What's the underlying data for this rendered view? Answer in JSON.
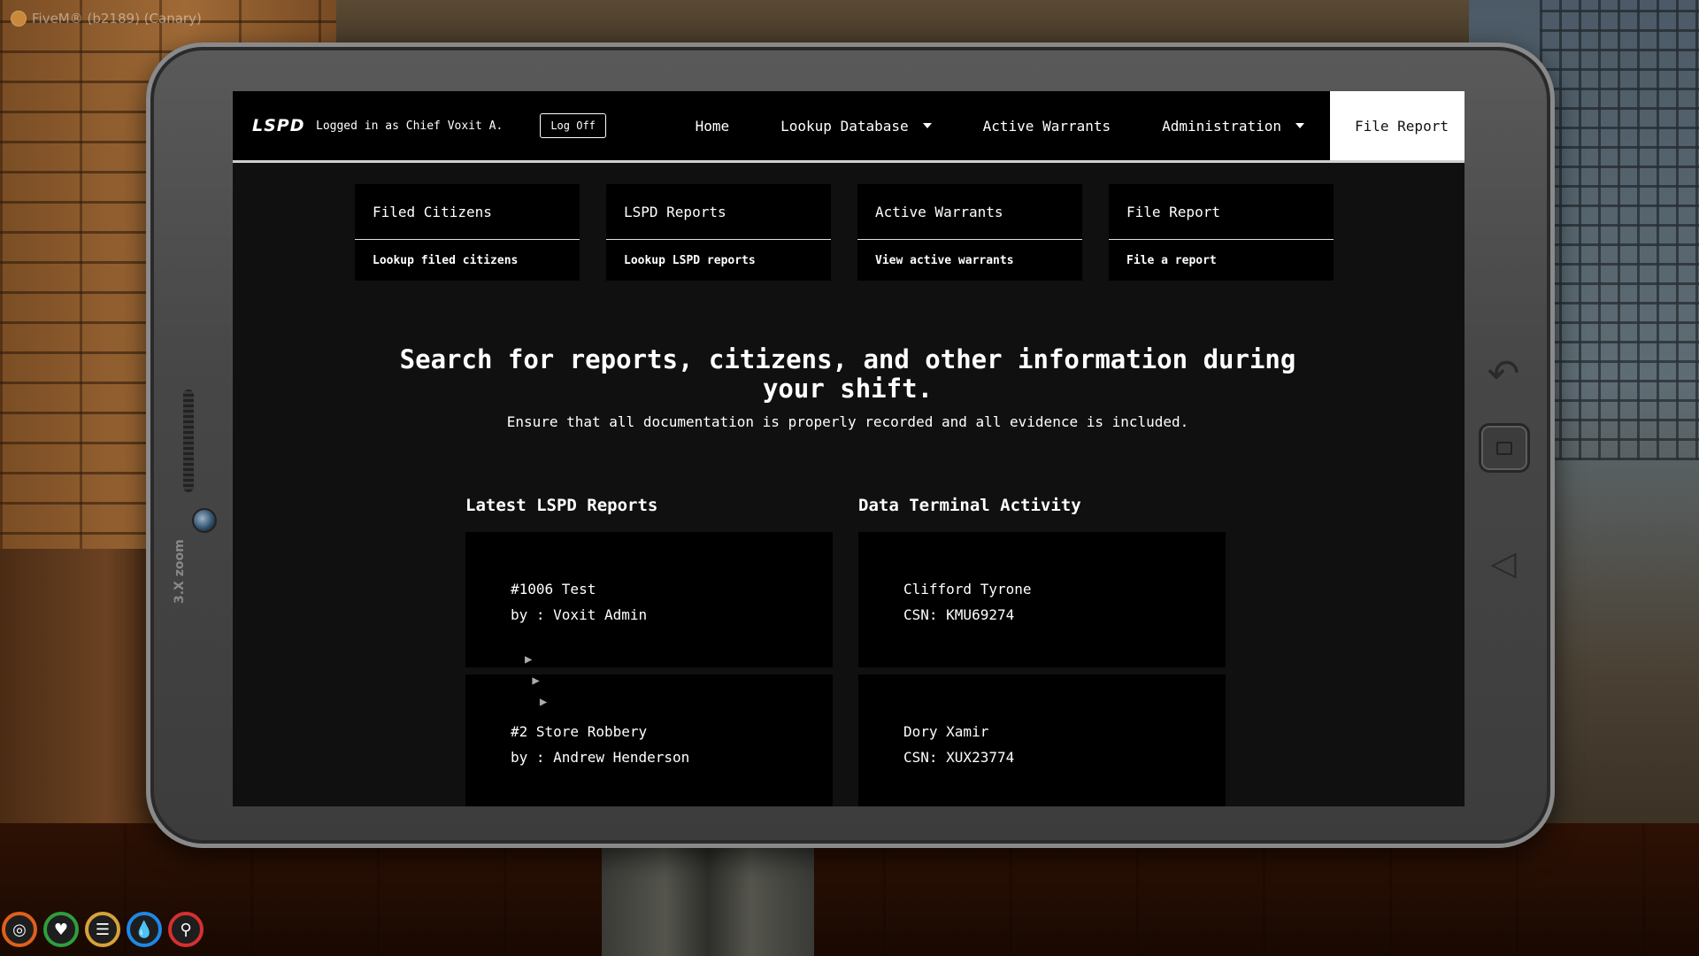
{
  "window": {
    "title": "FiveM® (b2189) (Canary)"
  },
  "tablet": {
    "zoom_label": "3.X zoom"
  },
  "navbar": {
    "brand": "LSPD",
    "logged_in_text": "Logged in as Chief Voxit A.",
    "log_off_label": "Log Off",
    "links": {
      "home": "Home",
      "lookup_database": "Lookup Database",
      "active_warrants": "Active Warrants",
      "administration": "Administration",
      "file_report": "File Report"
    }
  },
  "cards": [
    {
      "title": "Filed Citizens",
      "subtitle": "Lookup filed citizens"
    },
    {
      "title": "LSPD Reports",
      "subtitle": "Lookup LSPD reports"
    },
    {
      "title": "Active Warrants",
      "subtitle": "View active warrants"
    },
    {
      "title": "File Report",
      "subtitle": "File a report"
    }
  ],
  "hero": {
    "title": "Search for reports, citizens, and other information during your shift.",
    "subtitle": "Ensure that all documentation is properly recorded and all evidence is included."
  },
  "latest_reports": {
    "heading": "Latest LSPD Reports",
    "items": [
      {
        "title": "#1006 Test",
        "author": "by : Voxit Admin"
      },
      {
        "title": "#2 Store Robbery",
        "author": "by : Andrew Henderson"
      }
    ]
  },
  "terminal_activity": {
    "heading": "Data Terminal Activity",
    "items": [
      {
        "name": "Clifford Tyrone",
        "csn": "CSN: KMU69274"
      },
      {
        "name": "Dory Xamir",
        "csn": "CSN: XUX23774"
      }
    ]
  },
  "hud": {
    "icons": [
      "target-icon",
      "heart-icon",
      "food-icon",
      "water-icon",
      "stamina-icon"
    ],
    "colors": [
      "#e0601a",
      "#2e9e3e",
      "#d6a23a",
      "#1e88e5",
      "#d63030"
    ]
  }
}
